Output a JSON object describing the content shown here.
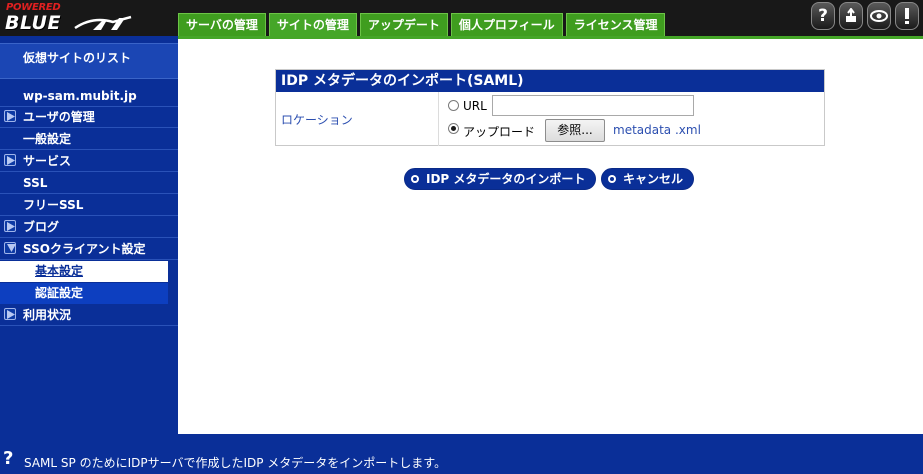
{
  "header": {
    "logo_powered": "POWERED",
    "logo_blue": "BLUE",
    "tabs": [
      {
        "label": "サーバの管理"
      },
      {
        "label": "サイトの管理"
      },
      {
        "label": "アップデート"
      },
      {
        "label": "個人プロフィール"
      },
      {
        "label": "ライセンス管理"
      }
    ],
    "active_tab": "サイトの管理",
    "icons": [
      "help-icon",
      "logout-icon",
      "eye-icon",
      "info-icon"
    ]
  },
  "sidebar": {
    "site_list": "仮想サイトのリスト",
    "site_name": "wp-sam.mubit.jp",
    "items": [
      {
        "label": "ユーザの管理",
        "expandable": true
      },
      {
        "label": "一般設定",
        "expandable": false
      },
      {
        "label": "サービス",
        "expandable": true
      },
      {
        "label": "SSL",
        "expandable": false
      },
      {
        "label": "フリーSSL",
        "expandable": false
      },
      {
        "label": "ブログ",
        "expandable": true
      },
      {
        "label": "SSOクライアント設定",
        "expandable": true,
        "expanded": true
      }
    ],
    "sub_items": [
      {
        "label": "基本設定",
        "active": true
      },
      {
        "label": "認証設定",
        "active": false
      }
    ],
    "last_item": {
      "label": "利用状況",
      "expandable": true
    }
  },
  "main": {
    "panel_title": "IDP メタデータのインポート(SAML)",
    "location_label": "ロケーション",
    "url_label": "URL",
    "url_value": "",
    "upload_label": "アップロード",
    "selected_option": "upload",
    "browse_label": "参照...",
    "filename": "metadata .xml",
    "import_button": "IDP メタデータのインポート",
    "cancel_button": "キャンセル"
  },
  "footer": {
    "help_symbol": "?",
    "text": "SAML SP のためにIDPサーバで作成したIDP メタデータをインポートします。"
  },
  "colors": {
    "nav_blue": "#0a2f98",
    "tab_green": "#3f9d1f",
    "header_black": "#181818"
  }
}
